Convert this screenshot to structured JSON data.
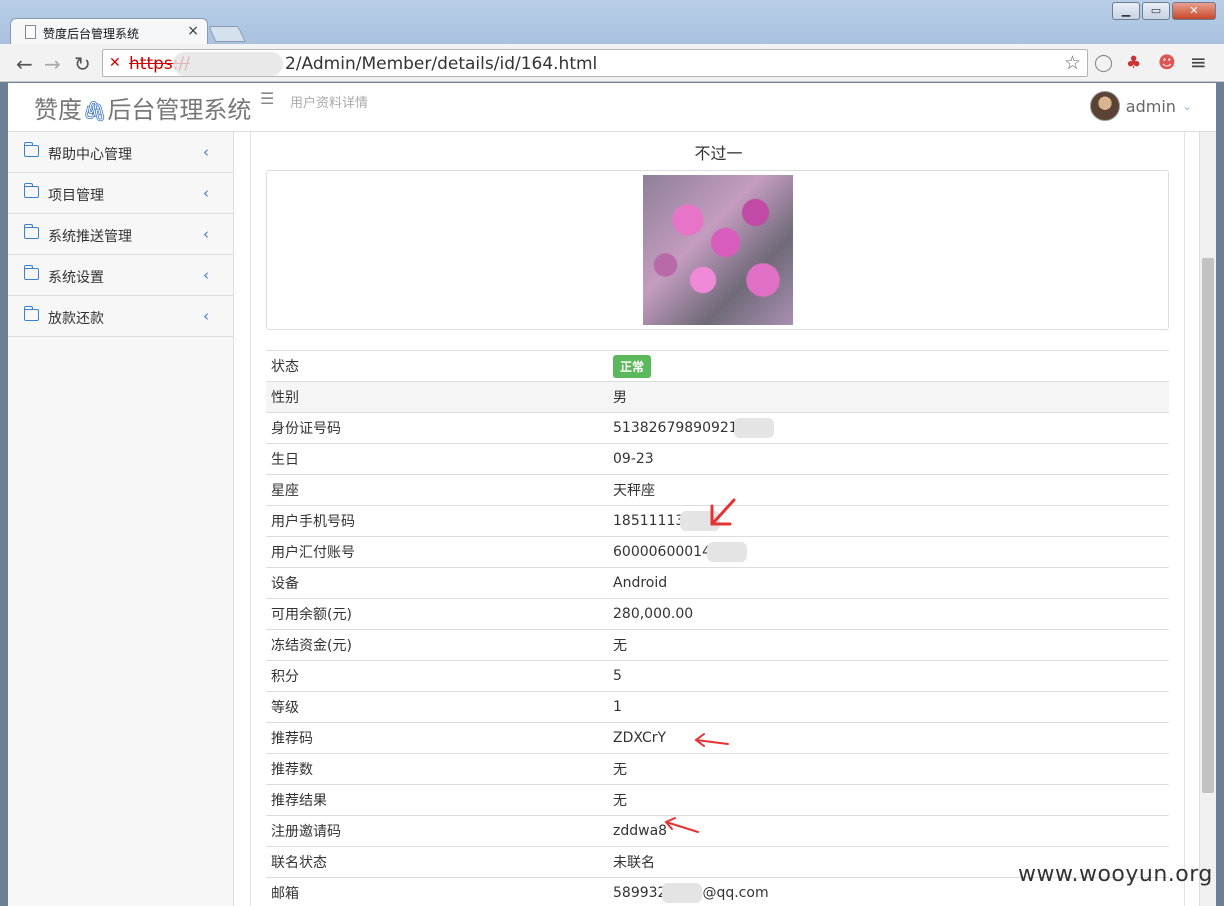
{
  "browser": {
    "tab_title": "赞度后台管理系统",
    "tab_close": "×",
    "url_scheme": "https://",
    "url_path": "2/Admin/Member/details/id/164.html",
    "win_min": "▁",
    "win_max": "▭",
    "win_close": "✕",
    "back": "←",
    "forward": "→",
    "reload": "↻",
    "star": "☆",
    "menu": "≡"
  },
  "header": {
    "logo_text_1": "赞度",
    "logo_text_2": "后台管理系统",
    "breadcrumb": "用户资料详情",
    "username": "admin",
    "caret": "⌄"
  },
  "sidebar": {
    "items": [
      {
        "label": "帮助中心管理"
      },
      {
        "label": "项目管理"
      },
      {
        "label": "系统推送管理"
      },
      {
        "label": "系统设置"
      },
      {
        "label": "放款还款"
      }
    ]
  },
  "profile": {
    "nickname": "不过一",
    "rows": [
      {
        "key": "状态",
        "value": "正常",
        "badge": true
      },
      {
        "key": "性别",
        "value": "男"
      },
      {
        "key": "身份证号码",
        "value": "51382679890921",
        "blur": true
      },
      {
        "key": "生日",
        "value": "09-23"
      },
      {
        "key": "星座",
        "value": "天秤座"
      },
      {
        "key": "用户手机号码",
        "value": "18511113",
        "blur": true
      },
      {
        "key": "用户汇付账号",
        "value": "60000600014",
        "blur": true
      },
      {
        "key": "设备",
        "value": "Android"
      },
      {
        "key": "可用余额(元)",
        "value": "280,000.00"
      },
      {
        "key": "冻结资金(元)",
        "value": "无"
      },
      {
        "key": "积分",
        "value": "5"
      },
      {
        "key": "等级",
        "value": "1"
      },
      {
        "key": "推荐码",
        "value": "ZDXCrY"
      },
      {
        "key": "推荐数",
        "value": "无"
      },
      {
        "key": "推荐结果",
        "value": "无"
      },
      {
        "key": "注册邀请码",
        "value": "zddwa8"
      },
      {
        "key": "联名状态",
        "value": "未联名"
      },
      {
        "key": "邮箱",
        "value": "589932",
        "value_suffix": "@qq.com",
        "blur": true
      }
    ]
  },
  "watermark": "www.wooyun.org",
  "colors": {
    "accent": "#3a80d0",
    "badge": "#5cb85c",
    "annotation": "#e53333"
  }
}
